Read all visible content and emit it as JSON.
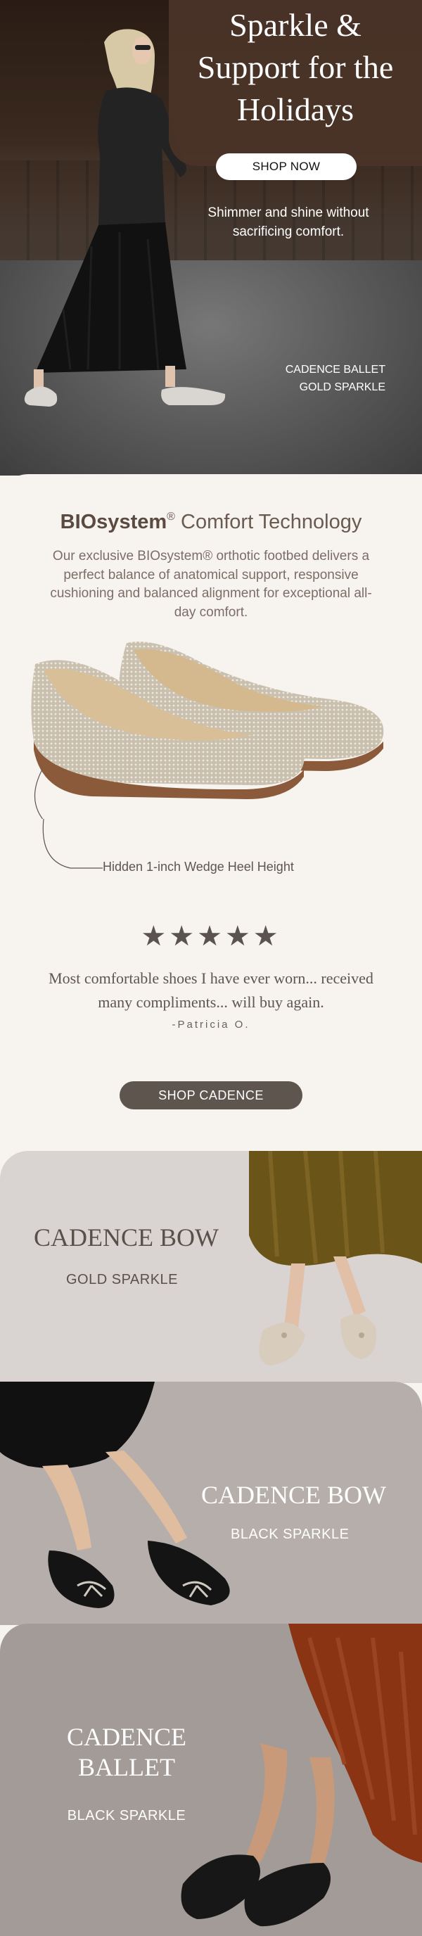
{
  "hero": {
    "title": "Sparkle & Support for the Holidays",
    "cta_label": "SHOP NOW",
    "subtitle": "Shimmer and shine without sacrificing comfort.",
    "caption_line1": "CADENCE BALLET",
    "caption_line2": "GOLD SPARKLE"
  },
  "biosystem": {
    "title_bold": "BIOsystem",
    "title_reg": "®",
    "title_rest": " Comfort Technology",
    "body": "Our exclusive BIOsystem® orthotic footbed delivers a perfect balance of anatomical support, responsive cushioning and balanced alignment for exceptional all-day comfort.",
    "wedge_caption": "Hidden 1-inch Wedge Heel Height"
  },
  "review": {
    "stars": "★★★★★",
    "rating": 5,
    "quote": "Most comfortable shoes I have ever worn... received many compliments... will buy again.",
    "author": "-Patricia O.",
    "cta_label": "SHOP CADENCE"
  },
  "products": [
    {
      "name": "CADENCE BOW",
      "variant": "GOLD SPARKLE"
    },
    {
      "name": "CADENCE BOW",
      "variant": "BLACK SPARKLE"
    },
    {
      "name_line1": "CADENCE",
      "name_line2": "BALLET",
      "variant": "BLACK SPARKLE"
    }
  ],
  "colors": {
    "hero_panel": "#4a3327",
    "button_dark": "#5e554f",
    "block1_bg": "#d9d4d1",
    "block2_bg": "#b6aeaa",
    "block3_bg": "#a39b98",
    "skirt_gold": "#6b5418",
    "skirt_rust": "#8a3414"
  }
}
